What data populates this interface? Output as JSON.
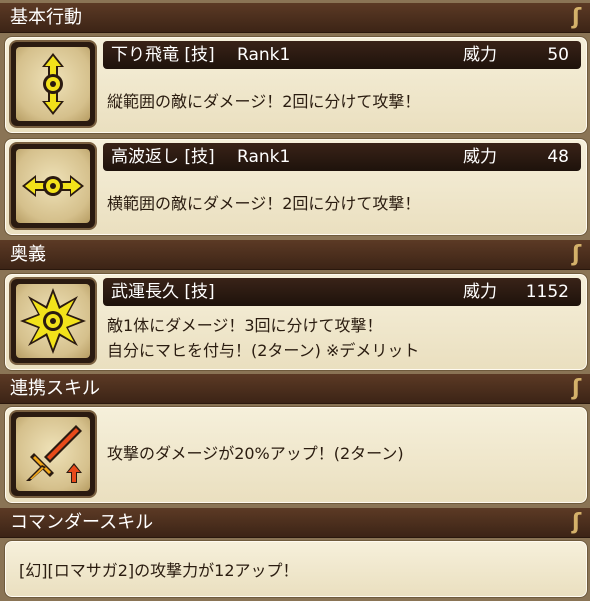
{
  "sections": {
    "basic": "基本行動",
    "ougi": "奥義",
    "link": "連携スキル",
    "commander": "コマンダースキル"
  },
  "skills": [
    {
      "name": "下り飛竜 [技]",
      "rank": "Rank1",
      "power_label": "威力",
      "power": "50",
      "icon": "vertical-range-icon",
      "desc": [
        "縦範囲の敵にダメージ！2回に分けて攻撃！"
      ]
    },
    {
      "name": "高波返し [技]",
      "rank": "Rank1",
      "power_label": "威力",
      "power": "48",
      "icon": "horizontal-range-icon",
      "desc": [
        "横範囲の敵にダメージ！2回に分けて攻撃！"
      ]
    }
  ],
  "ougi_skill": {
    "name": "武運長久 [技]",
    "power_label": "威力",
    "power": "1152",
    "icon": "burst-star-icon",
    "desc": [
      "敵1体にダメージ！3回に分けて攻撃！",
      "自分にマヒを付与！(2ターン) ※デメリット"
    ]
  },
  "link_skill": {
    "icon": "sword-attack-up-icon",
    "desc": "攻撃のダメージが20%アップ！(2ターン)"
  },
  "commander_skill": {
    "desc": "[幻][ロマサガ2]の攻撃力が12アップ！"
  },
  "colors": {
    "header_bg": "#3c2416",
    "panel_bg": "#f1e8cc",
    "icon_yellow": "#f2e21a"
  }
}
